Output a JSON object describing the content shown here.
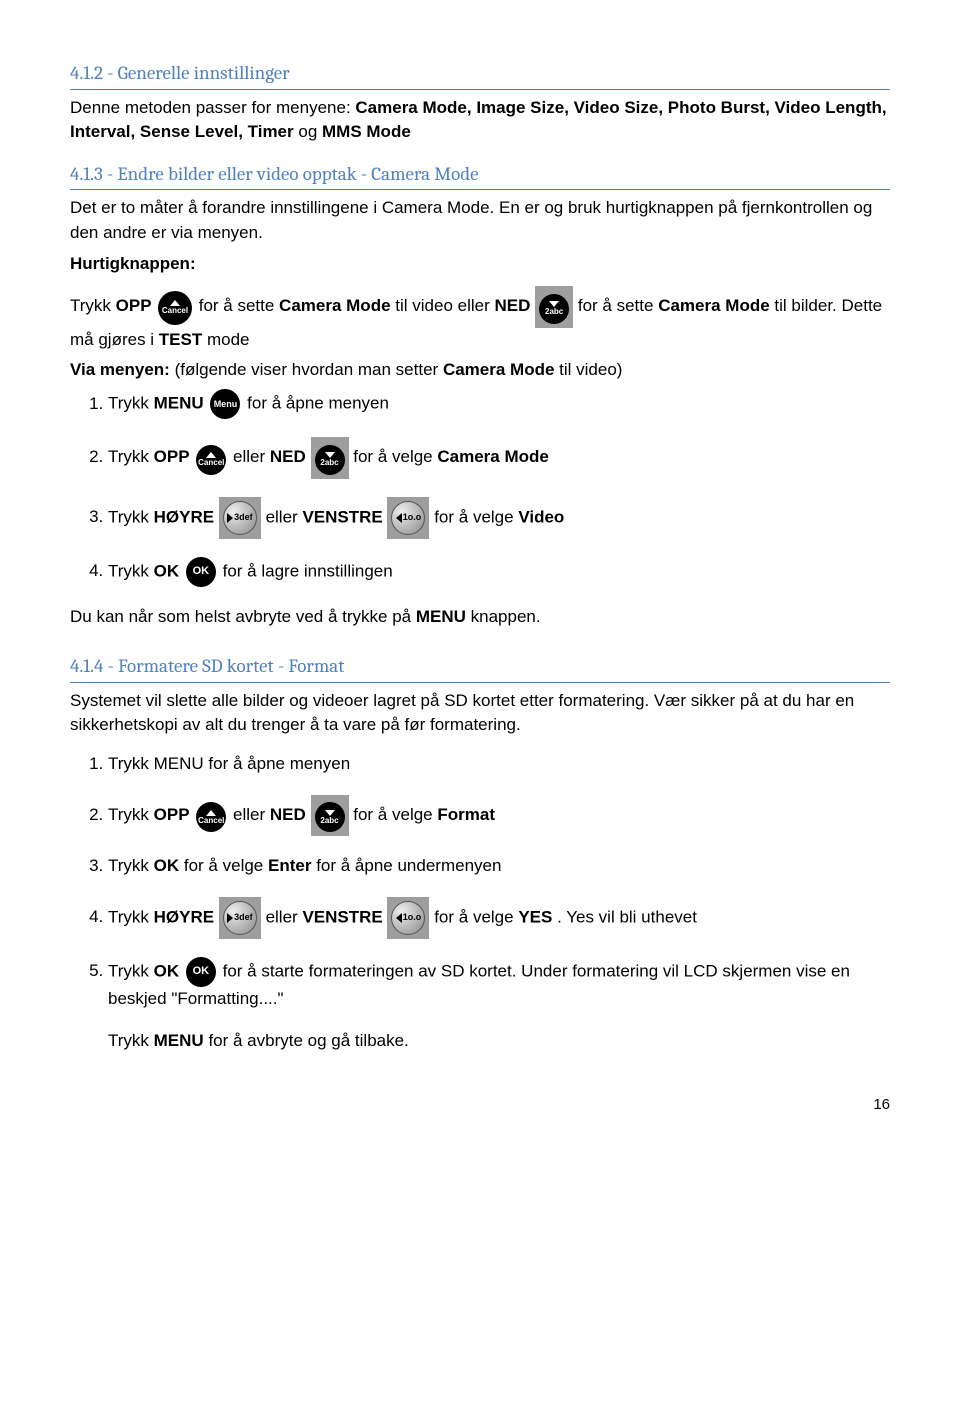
{
  "section1": {
    "heading": "4.1.2 - Generelle innstillinger",
    "p1a": "Denne metoden passer for menyene: ",
    "p1b": "Camera Mode, Image Size, Video Size, Photo Burst, Video Length, Interval, Sense Level, Timer",
    "p1c": " og ",
    "p1d": "MMS Mode"
  },
  "section2": {
    "heading": "4.1.3 - Endre  bilder eller video opptak - Camera Mode",
    "p1": "Det er to måter å forandre innstillingene i Camera Mode. En er og bruk hurtigknappen på fjernkontrollen og den andre er via menyen.",
    "hurtig_label": "Hurtigknappen:",
    "line1_a": "Trykk",
    "line1_opp": " OPP ",
    "line1_b": " for å sette ",
    "line1_cm": "Camera Mode",
    "line1_c": " til video eller",
    "line1_ned": " NED ",
    "line1_d": " for å sette ",
    "line1_cm2": "Camera Mode",
    "line1_e": " til bilder. Dette må gjøres i ",
    "line1_test": "TEST",
    "line1_f": " mode",
    "via_a": "Via menyen:",
    "via_b": " (følgende viser hvordan man setter ",
    "via_c": "Camera Mode",
    "via_d": " til video)",
    "li1_a": "Trykk ",
    "li1_menu": "MENU",
    "li1_b": " for å åpne menyen",
    "li2_a": "Trykk ",
    "li2_opp": "OPP",
    "li2_b": " eller ",
    "li2_ned": "NED",
    "li2_c": " for å velge ",
    "li2_cm": "Camera Mode",
    "li3_a": "Trykk ",
    "li3_h": "HØYRE",
    "li3_b": " eller ",
    "li3_v": "VENSTRE",
    "li3_c": " for å velge ",
    "li3_video": "Video",
    "li4_a": "Trykk ",
    "li4_ok": "OK",
    "li4_b": " for å lagre innstillingen",
    "outro_a": "Du kan når som helst avbryte ved å trykke på ",
    "outro_b": "MENU",
    "outro_c": " knappen."
  },
  "section3": {
    "heading": "4.1.4 - Formatere SD kortet - Format",
    "p1": "Systemet vil slette alle bilder og videoer lagret på SD kortet etter formatering. Vær sikker på at du har en sikkerhetskopi av alt du trenger å ta vare på før formatering.",
    "li1": "Trykk MENU for å åpne menyen",
    "li2_a": "Trykk ",
    "li2_opp": "OPP",
    "li2_b": " eller ",
    "li2_ned": "NED",
    "li2_c": " for å velge ",
    "li2_fmt": "Format",
    "li3_a": "Trykk ",
    "li3_ok": "OK",
    "li3_b": " for å velge ",
    "li3_enter": "Enter",
    "li3_c": " for å åpne undermenyen",
    "li4_a": "Trykk ",
    "li4_h": "HØYRE",
    "li4_b": " eller ",
    "li4_v": "VENSTRE",
    "li4_c": " for å velge ",
    "li4_yes": "YES",
    "li4_d": ". Yes vil bli uthevet",
    "li5_a": "Trykk ",
    "li5_ok": "OK",
    "li5_b": " for å starte formateringen av SD kortet. Under formatering vil LCD skjermen vise en beskjed \"Formatting....\"",
    "outro_a": "Trykk ",
    "outro_b": "MENU",
    "outro_c": " for å avbryte og gå tilbake."
  },
  "icons": {
    "cancel": "Cancel",
    "2abc": "2abc",
    "menu": "Menu",
    "ok": "OK",
    "3def": "3def",
    "1oo": "1o.o"
  },
  "page_number": "16"
}
